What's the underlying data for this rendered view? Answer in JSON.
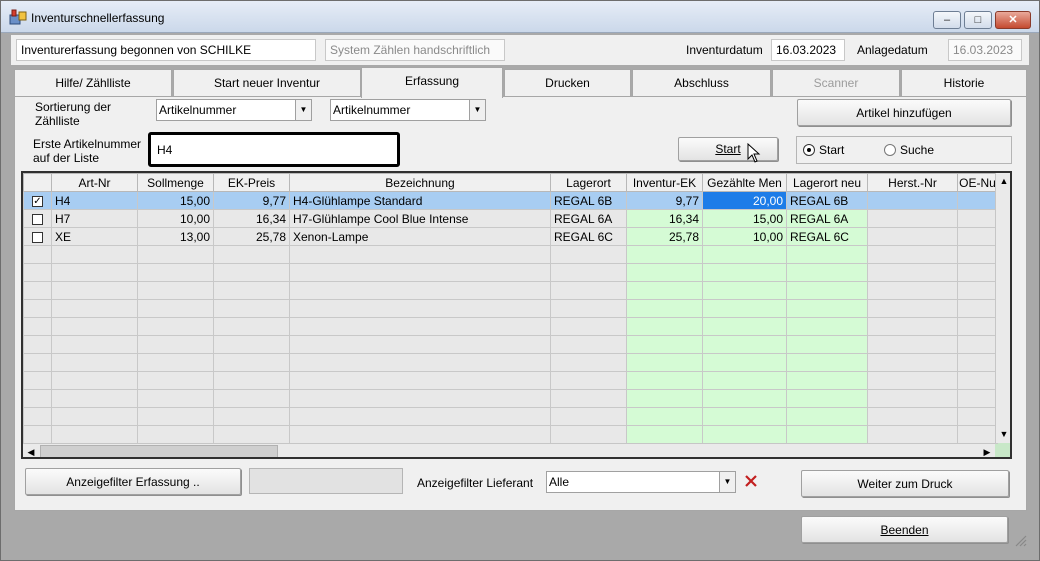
{
  "window": {
    "title": "Inventurschnellerfassung",
    "controls": {
      "minimize": "–",
      "maximize": "□",
      "close": "✕"
    }
  },
  "header": {
    "started_by": "Inventurerfassung begonnen von SCHILKE",
    "count_mode": "System Zählen handschriftlich",
    "inventory_date_label": "Inventurdatum",
    "inventory_date": "16.03.2023",
    "creation_date_label": "Anlagedatum",
    "creation_date": "16.03.2023"
  },
  "tabs": [
    {
      "label": "Hilfe/ Zählliste",
      "state": "normal"
    },
    {
      "label": "Start neuer Inventur",
      "state": "normal"
    },
    {
      "label": "Erfassung",
      "state": "active"
    },
    {
      "label": "Drucken",
      "state": "normal"
    },
    {
      "label": "Abschluss",
      "state": "normal"
    },
    {
      "label": "Scanner",
      "state": "disabled"
    },
    {
      "label": "Historie",
      "state": "normal"
    }
  ],
  "controls": {
    "sort_label": "Sortierung der Zählliste",
    "sort_value_1": "Artikelnummer",
    "sort_value_2": "Artikelnummer",
    "add_article_button": "Artikel hinzufügen",
    "first_article_label": "Erste Artikelnummer auf der Liste",
    "first_article_value": "H4",
    "start_button": "Start",
    "radio_start": "Start",
    "radio_search": "Suche",
    "radio_selected": "Start"
  },
  "grid": {
    "columns": [
      "",
      "Art-Nr",
      "Sollmenge",
      "EK-Preis",
      "Bezeichnung",
      "Lagerort",
      "Inventur-EK",
      "Gezählte Men",
      "Lagerort neu",
      "Herst.-Nr",
      "OE-Nu"
    ],
    "rows": [
      {
        "checked": true,
        "art_nr": "H4",
        "sollmenge": "15,00",
        "ek_preis": "9,77",
        "bezeichnung": "H4-Glühlampe Standard",
        "lagerort": "REGAL 6B",
        "inventur_ek": "9,77",
        "gezaehlt": "20,00",
        "lagerort_neu": "REGAL 6B",
        "herst_nr": "",
        "oe_nr": "",
        "selected": true
      },
      {
        "checked": false,
        "art_nr": "H7",
        "sollmenge": "10,00",
        "ek_preis": "16,34",
        "bezeichnung": "H7-Glühlampe Cool Blue Intense",
        "lagerort": "REGAL 6A",
        "inventur_ek": "16,34",
        "gezaehlt": "15,00",
        "lagerort_neu": "REGAL 6A",
        "herst_nr": "",
        "oe_nr": "",
        "selected": false
      },
      {
        "checked": false,
        "art_nr": "XE",
        "sollmenge": "13,00",
        "ek_preis": "25,78",
        "bezeichnung": "Xenon-Lampe",
        "lagerort": "REGAL 6C",
        "inventur_ek": "25,78",
        "gezaehlt": "10,00",
        "lagerort_neu": "REGAL 6C",
        "herst_nr": "",
        "oe_nr": "",
        "selected": false
      }
    ],
    "colors": {
      "selected_row": "#a8cdf2",
      "highlight_cell": "#1d7ce8",
      "editable_column": "#d5fbd5"
    }
  },
  "footer": {
    "display_filter_button": "Anzeigefilter Erfassung ..",
    "supplier_filter_label": "Anzeigefilter Lieferant",
    "supplier_filter_value": "Alle",
    "clear_filter_icon": "x-icon",
    "to_print_button": "Weiter zum Druck",
    "exit_button": "Beenden"
  }
}
